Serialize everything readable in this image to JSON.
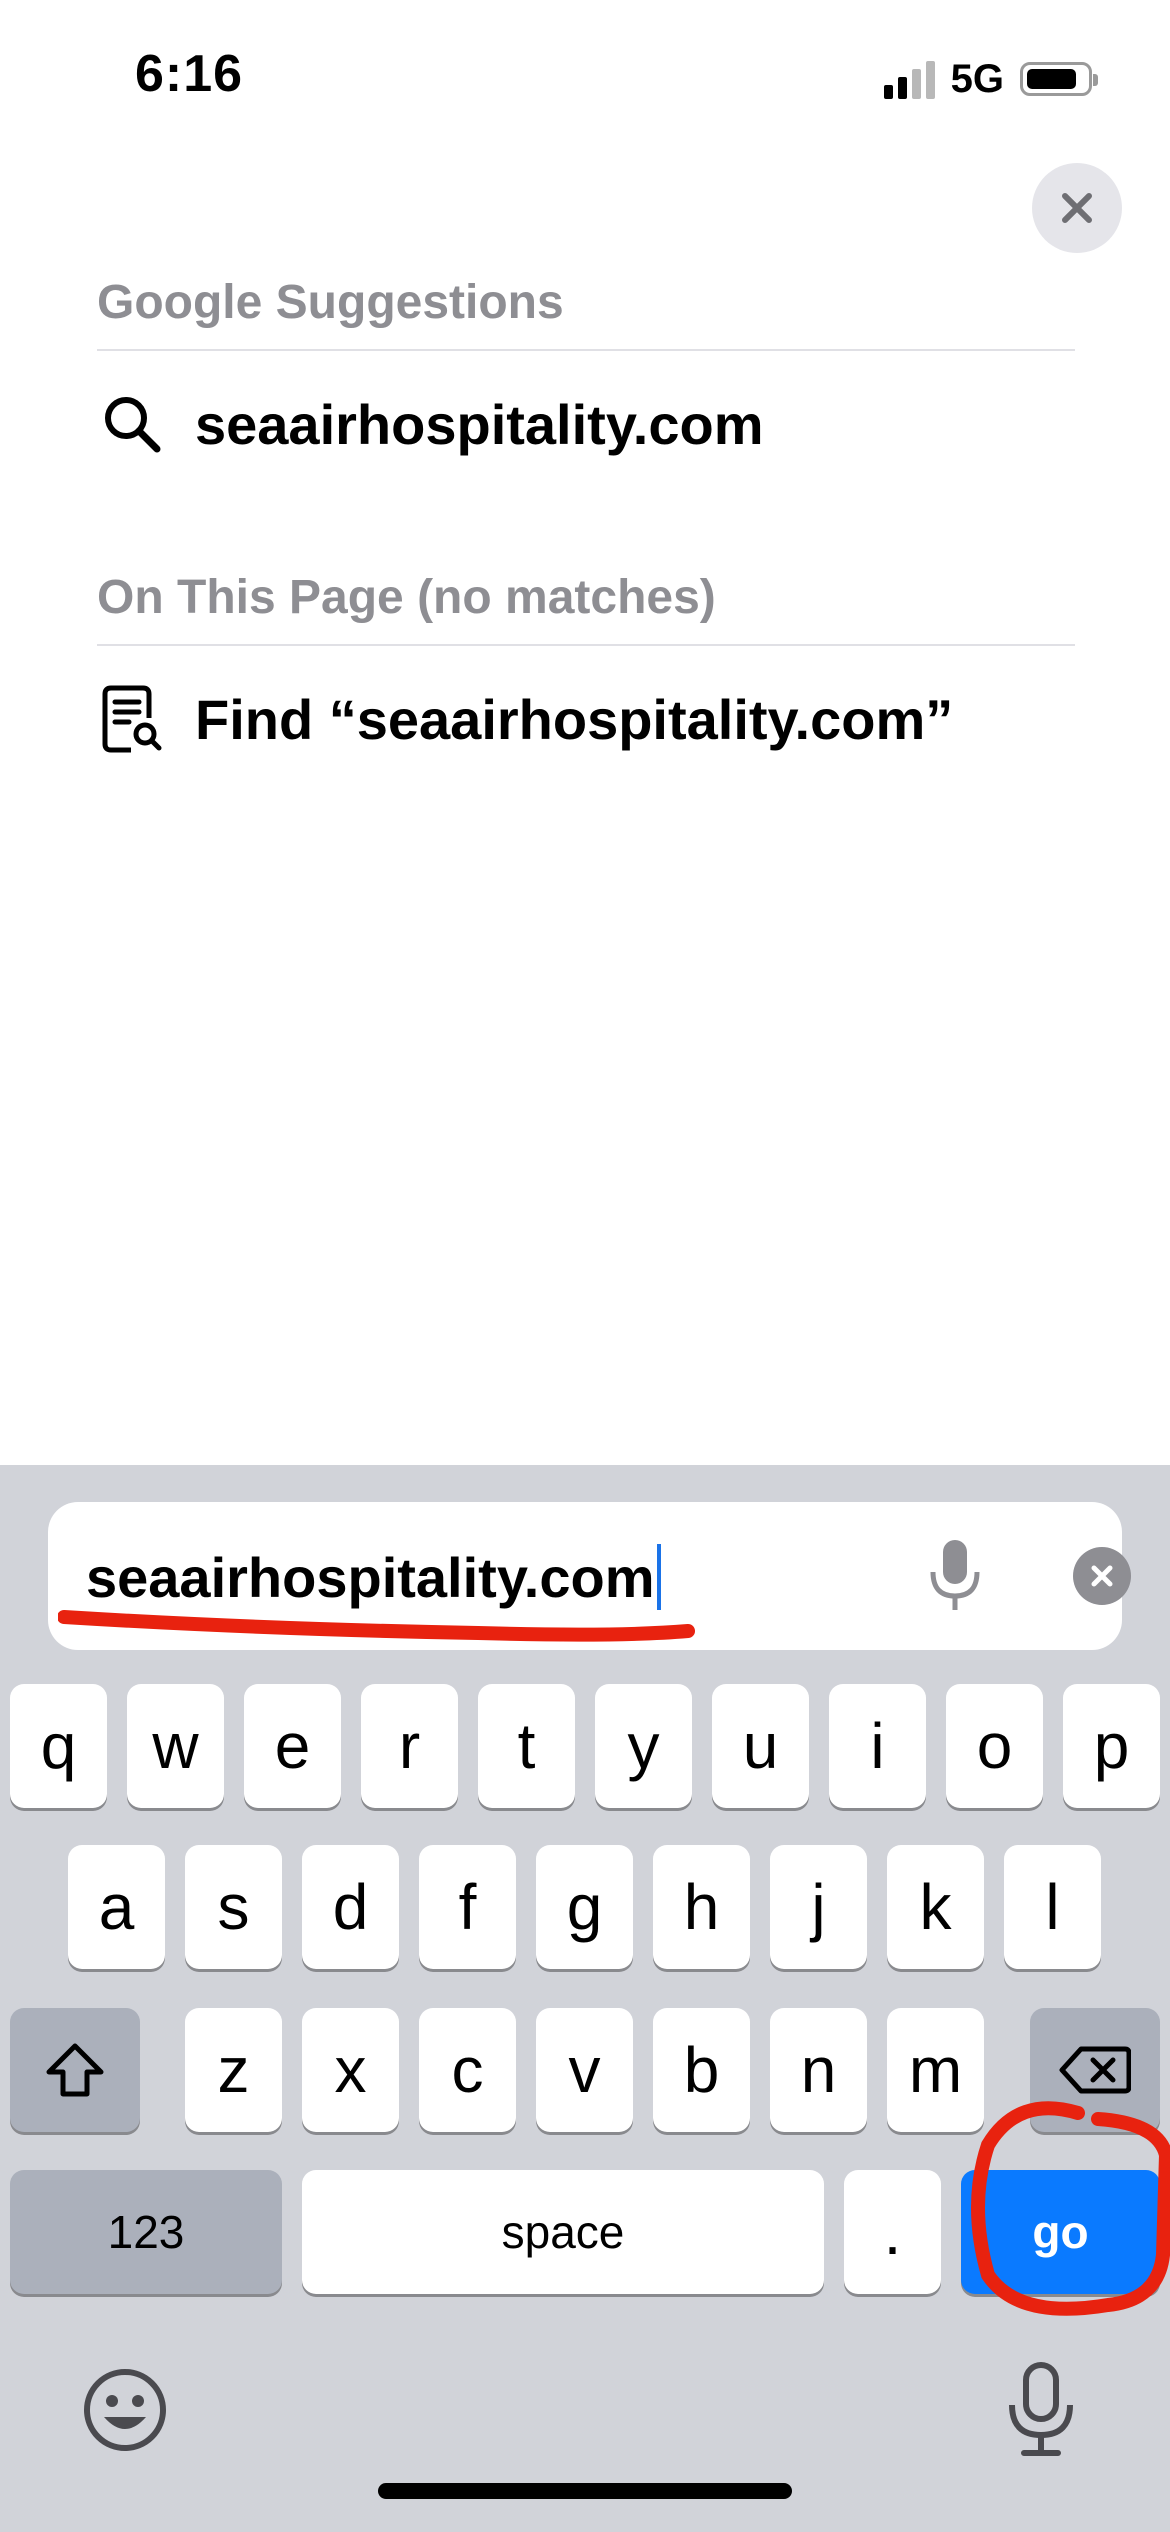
{
  "status_bar": {
    "time": "6:16",
    "network": "5G",
    "battery_level": 0.85
  },
  "close_button": {
    "icon": "close-icon"
  },
  "sections": [
    {
      "header": "Google Suggestions",
      "item": {
        "icon": "search-icon",
        "label": "seaairhospitality.com"
      }
    },
    {
      "header": "On This Page (no matches)",
      "item": {
        "icon": "find-in-page-icon",
        "label": "Find “seaairhospitality.com”"
      }
    }
  ],
  "url_field": {
    "value": "seaairhospitality.com",
    "mic_icon": "microphone-icon",
    "clear_icon": "clear-icon"
  },
  "keyboard": {
    "row1": [
      "q",
      "w",
      "e",
      "r",
      "t",
      "y",
      "u",
      "i",
      "o",
      "p"
    ],
    "row2": [
      "a",
      "s",
      "d",
      "f",
      "g",
      "h",
      "j",
      "k",
      "l"
    ],
    "row3": [
      "z",
      "x",
      "c",
      "v",
      "b",
      "n",
      "m"
    ],
    "shift_icon": "shift-icon",
    "delete_icon": "backspace-icon",
    "numbers_label": "123",
    "space_label": "space",
    "period_label": ".",
    "go_label": "go",
    "emoji_icon": "emoji-icon",
    "dictation_icon": "microphone-icon"
  },
  "annotation_color": "#e8220f",
  "accent_color": "#0a7aff"
}
